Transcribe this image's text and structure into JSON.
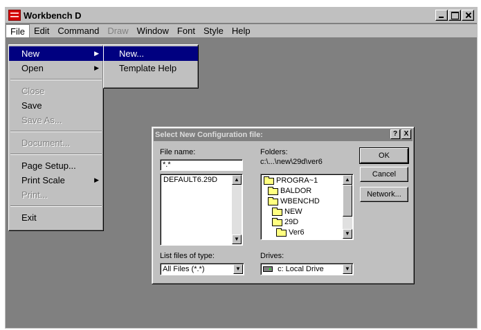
{
  "window": {
    "title": "Workbench D",
    "controls": [
      "minimize",
      "maximize",
      "close"
    ]
  },
  "menubar": {
    "items": [
      {
        "label": "File",
        "enabled": true
      },
      {
        "label": "Edit",
        "enabled": true
      },
      {
        "label": "Command",
        "enabled": true
      },
      {
        "label": "Draw",
        "enabled": false
      },
      {
        "label": "Window",
        "enabled": true
      },
      {
        "label": "Font",
        "enabled": true
      },
      {
        "label": "Style",
        "enabled": true
      },
      {
        "label": "Help",
        "enabled": true
      }
    ]
  },
  "file_menu": {
    "new": "New",
    "open": "Open",
    "close": "Close",
    "save": "Save",
    "save_as": "Save As...",
    "document": "Document...",
    "page_setup": "Page Setup...",
    "print_scale": "Print Scale",
    "print": "Print...",
    "exit": "Exit"
  },
  "new_submenu": {
    "new": "New...",
    "template_help": "Template Help"
  },
  "dialog": {
    "title": "Select New Configuration file:",
    "help_btn": "?",
    "close_btn": "X",
    "file_name_label": "File name:",
    "file_name_value": "*.*",
    "files": [
      "DEFAULT6.29D"
    ],
    "folders_label": "Folders:",
    "folders_path": "c:\\...\\new\\29d\\ver6",
    "folders": [
      "PROGRA~1",
      "BALDOR",
      "WBENCHD",
      "NEW",
      "29D",
      "Ver6"
    ],
    "ok": "OK",
    "cancel": "Cancel",
    "network": "Network...",
    "list_type_label": "List files of type:",
    "list_type_value": "All Files (*.*)",
    "drives_label": "Drives:",
    "drives_value": "c: Local Drive"
  }
}
